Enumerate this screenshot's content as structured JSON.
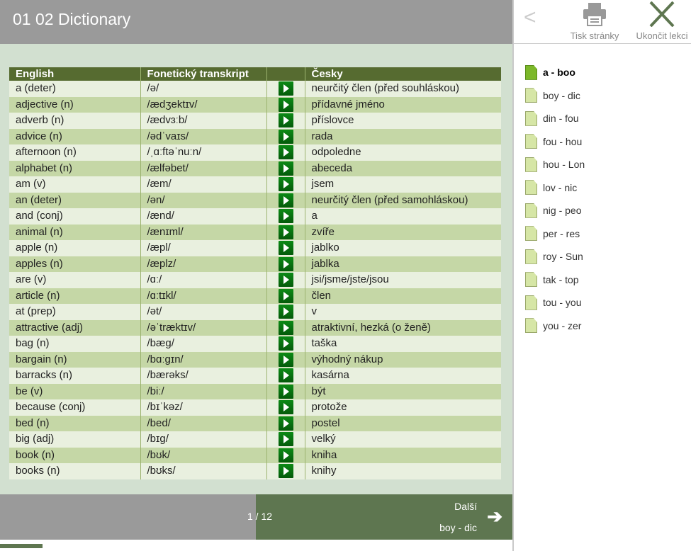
{
  "header": {
    "title": "01 02 Dictionary"
  },
  "table": {
    "columns": [
      "English",
      "Fonetický transkript",
      "",
      "Česky"
    ],
    "rows": [
      [
        "a (deter)",
        "/ə/",
        "neurčitý člen (před souhláskou)"
      ],
      [
        "adjective (n)",
        "/ædʒektɪv/",
        "přídavné jméno"
      ],
      [
        "adverb (n)",
        "/ædvɜːb/",
        "příslovce"
      ],
      [
        "advice (n)",
        "/ədˈvaɪs/",
        "rada"
      ],
      [
        "afternoon (n)",
        "/ˌɑːftəˈnuːn/",
        "odpoledne"
      ],
      [
        "alphabet (n)",
        "/ælfəbet/",
        "abeceda"
      ],
      [
        "am (v)",
        "/æm/",
        "jsem"
      ],
      [
        "an (deter)",
        "/ən/",
        "neurčitý člen (před samohláskou)"
      ],
      [
        "and (conj)",
        "/ænd/",
        "a"
      ],
      [
        "animal (n)",
        "/ænɪml/",
        "zvíře"
      ],
      [
        "apple (n)",
        "/æpl/",
        "jablko"
      ],
      [
        "apples (n)",
        "/æplz/",
        "jablka"
      ],
      [
        "are (v)",
        "/ɑː/",
        "jsi/jsme/jste/jsou"
      ],
      [
        "article (n)",
        "/ɑːtɪkl/",
        "člen"
      ],
      [
        "at (prep)",
        "/ət/",
        "v"
      ],
      [
        "attractive (adj)",
        "/əˈtræktɪv/",
        "atraktivní, hezká (o ženě)"
      ],
      [
        "bag (n)",
        "/bæg/",
        "taška"
      ],
      [
        "bargain (n)",
        "/bɑːgɪn/",
        "výhodný nákup"
      ],
      [
        "barracks (n)",
        "/bærəks/",
        "kasárna"
      ],
      [
        "be (v)",
        "/biː/",
        "být"
      ],
      [
        "because (conj)",
        "/bɪˈkəz/",
        "protože"
      ],
      [
        "bed (n)",
        "/bed/",
        "postel"
      ],
      [
        "big (adj)",
        "/bɪg/",
        "velký"
      ],
      [
        "book (n)",
        "/bʊk/",
        "kniha"
      ],
      [
        "books (n)",
        "/bʊks/",
        "knihy"
      ]
    ]
  },
  "footer": {
    "pager": "1 / 12",
    "next_label": "Další",
    "next_sub": "boy - dic",
    "next_icon": "arrow-right-icon",
    "progress_fraction": 0.0833
  },
  "sidebar": {
    "back_icon": "chevron-left-icon",
    "print_label": "Tisk stránky",
    "close_label": "Ukončit lekci",
    "items": [
      {
        "label": "a - boo",
        "active": true
      },
      {
        "label": "boy - dic"
      },
      {
        "label": "din - fou"
      },
      {
        "label": "fou - hou"
      },
      {
        "label": "hou - Lon"
      },
      {
        "label": "lov - nic"
      },
      {
        "label": "nig - peo"
      },
      {
        "label": "per - res"
      },
      {
        "label": "roy - Sun"
      },
      {
        "label": "tak - top"
      },
      {
        "label": "tou - you"
      },
      {
        "label": "you - zer"
      }
    ]
  },
  "colors": {
    "header": "#9a9a9a",
    "table_header": "#566b30",
    "row_light": "#e9f0df",
    "row_dark": "#c5d7a6",
    "footer_green": "#5e7650",
    "active_doc": "#7cb82a"
  }
}
